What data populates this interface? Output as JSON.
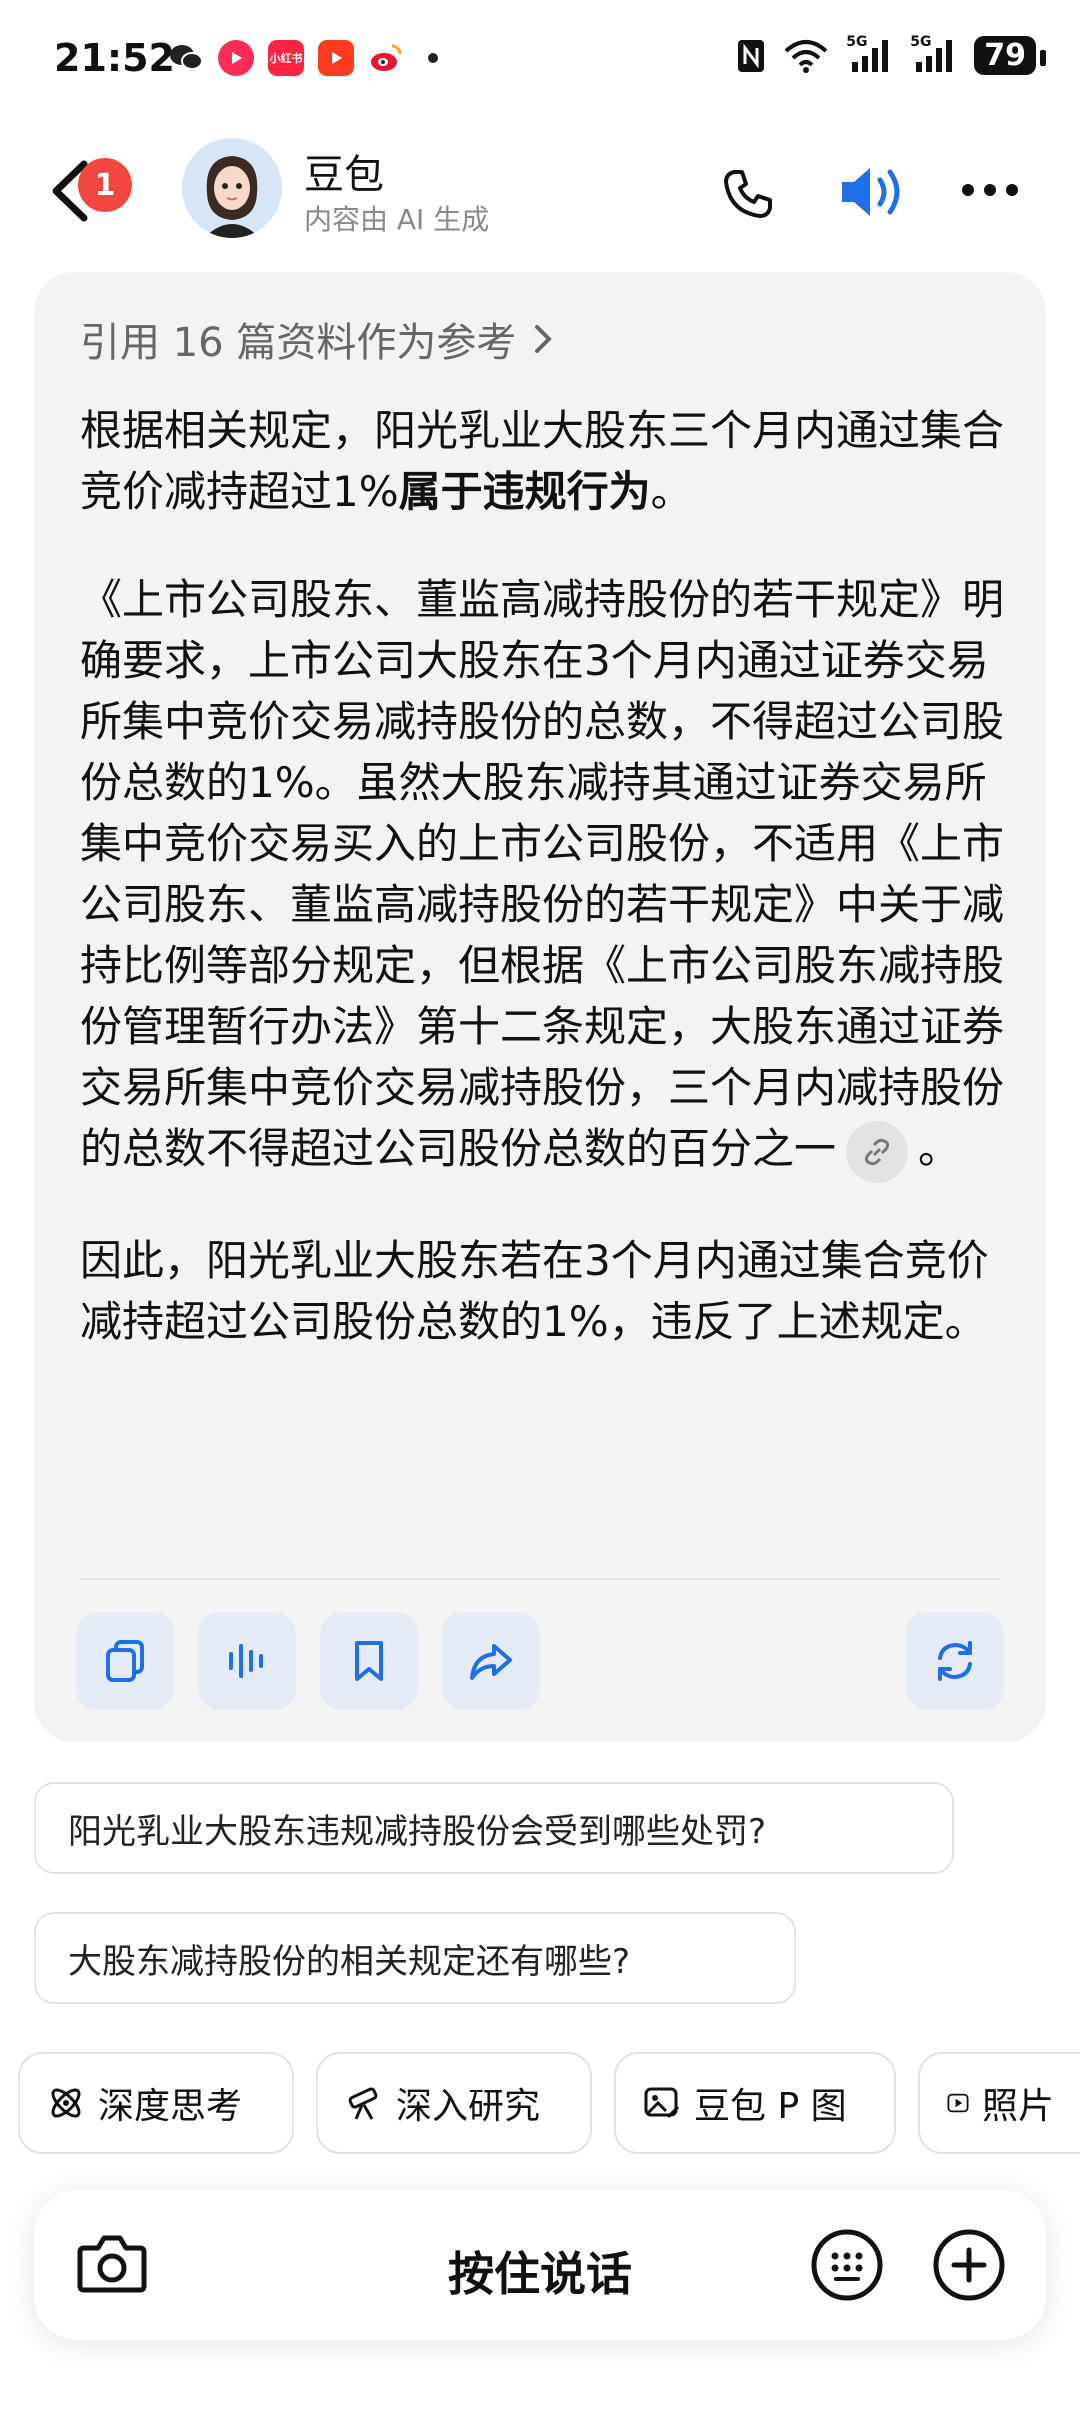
{
  "status_bar": {
    "time": "21:52",
    "apps": [
      {
        "icon": "wechat-icon",
        "color": "#222222"
      },
      {
        "icon": "red-play-icon",
        "color": "#ff2d55"
      },
      {
        "icon": "xiaohongshu-icon",
        "color": "#ff2442",
        "label": "小红书"
      },
      {
        "icon": "youtube-icon",
        "color": "#ff3b1f"
      },
      {
        "icon": "weibo-icon",
        "color": "#f5a623"
      }
    ],
    "network": "5G",
    "network2": "5G",
    "battery": "79"
  },
  "header": {
    "unread_badge": "1",
    "bot_name": "豆包",
    "bot_subtitle": "内容由 AI 生成"
  },
  "message": {
    "reference_text": "引用 16 篇资料作为参考",
    "para1_normal": "根据相关规定，阳光乳业大股东三个月内通过集合竞价减持超过1%",
    "para1_bold": "属于违规行为",
    "para1_end": "。",
    "para2": "《上市公司股东、董监高减持股份的若干规定》明确要求，上市公司大股东在3个月内通过证券交易所集中竞价交易减持股份的总数，不得超过公司股份总数的1%。虽然大股东减持其通过证券交易所集中竞价交易买入的上市公司股份，不适用《上市公司股东、董监高减持股份的若干规定》中关于减持比例等部分规定，但根据《上市公司股东减持股份管理暂行办法》第十二条规定，大股东通过证券交易所集中竞价交易减持股份，三个月内减持股份的总数不得超过公司股份总数的百分之一",
    "para2_end": "。",
    "para3": "因此，阳光乳业大股东若在3个月内通过集合竞价减持超过公司股份总数的1%，违反了上述规定。"
  },
  "suggestions": [
    "阳光乳业大股东违规减持股份会受到哪些处罚?",
    "大股东减持股份的相关规定还有哪些?"
  ],
  "tools": [
    {
      "label": "深度思考",
      "icon": "atom-icon"
    },
    {
      "label": "深入研究",
      "icon": "telescope-icon"
    },
    {
      "label": "豆包 P 图",
      "icon": "image-edit-icon"
    },
    {
      "label": "照片",
      "icon": "video-icon"
    }
  ],
  "input": {
    "hold_to_talk": "按住说话"
  },
  "colors": {
    "accent_blue": "#1e6fe8",
    "badge_red": "#f2473f",
    "card_bg": "#f3f3f4",
    "action_bg": "#e4ebf6"
  }
}
